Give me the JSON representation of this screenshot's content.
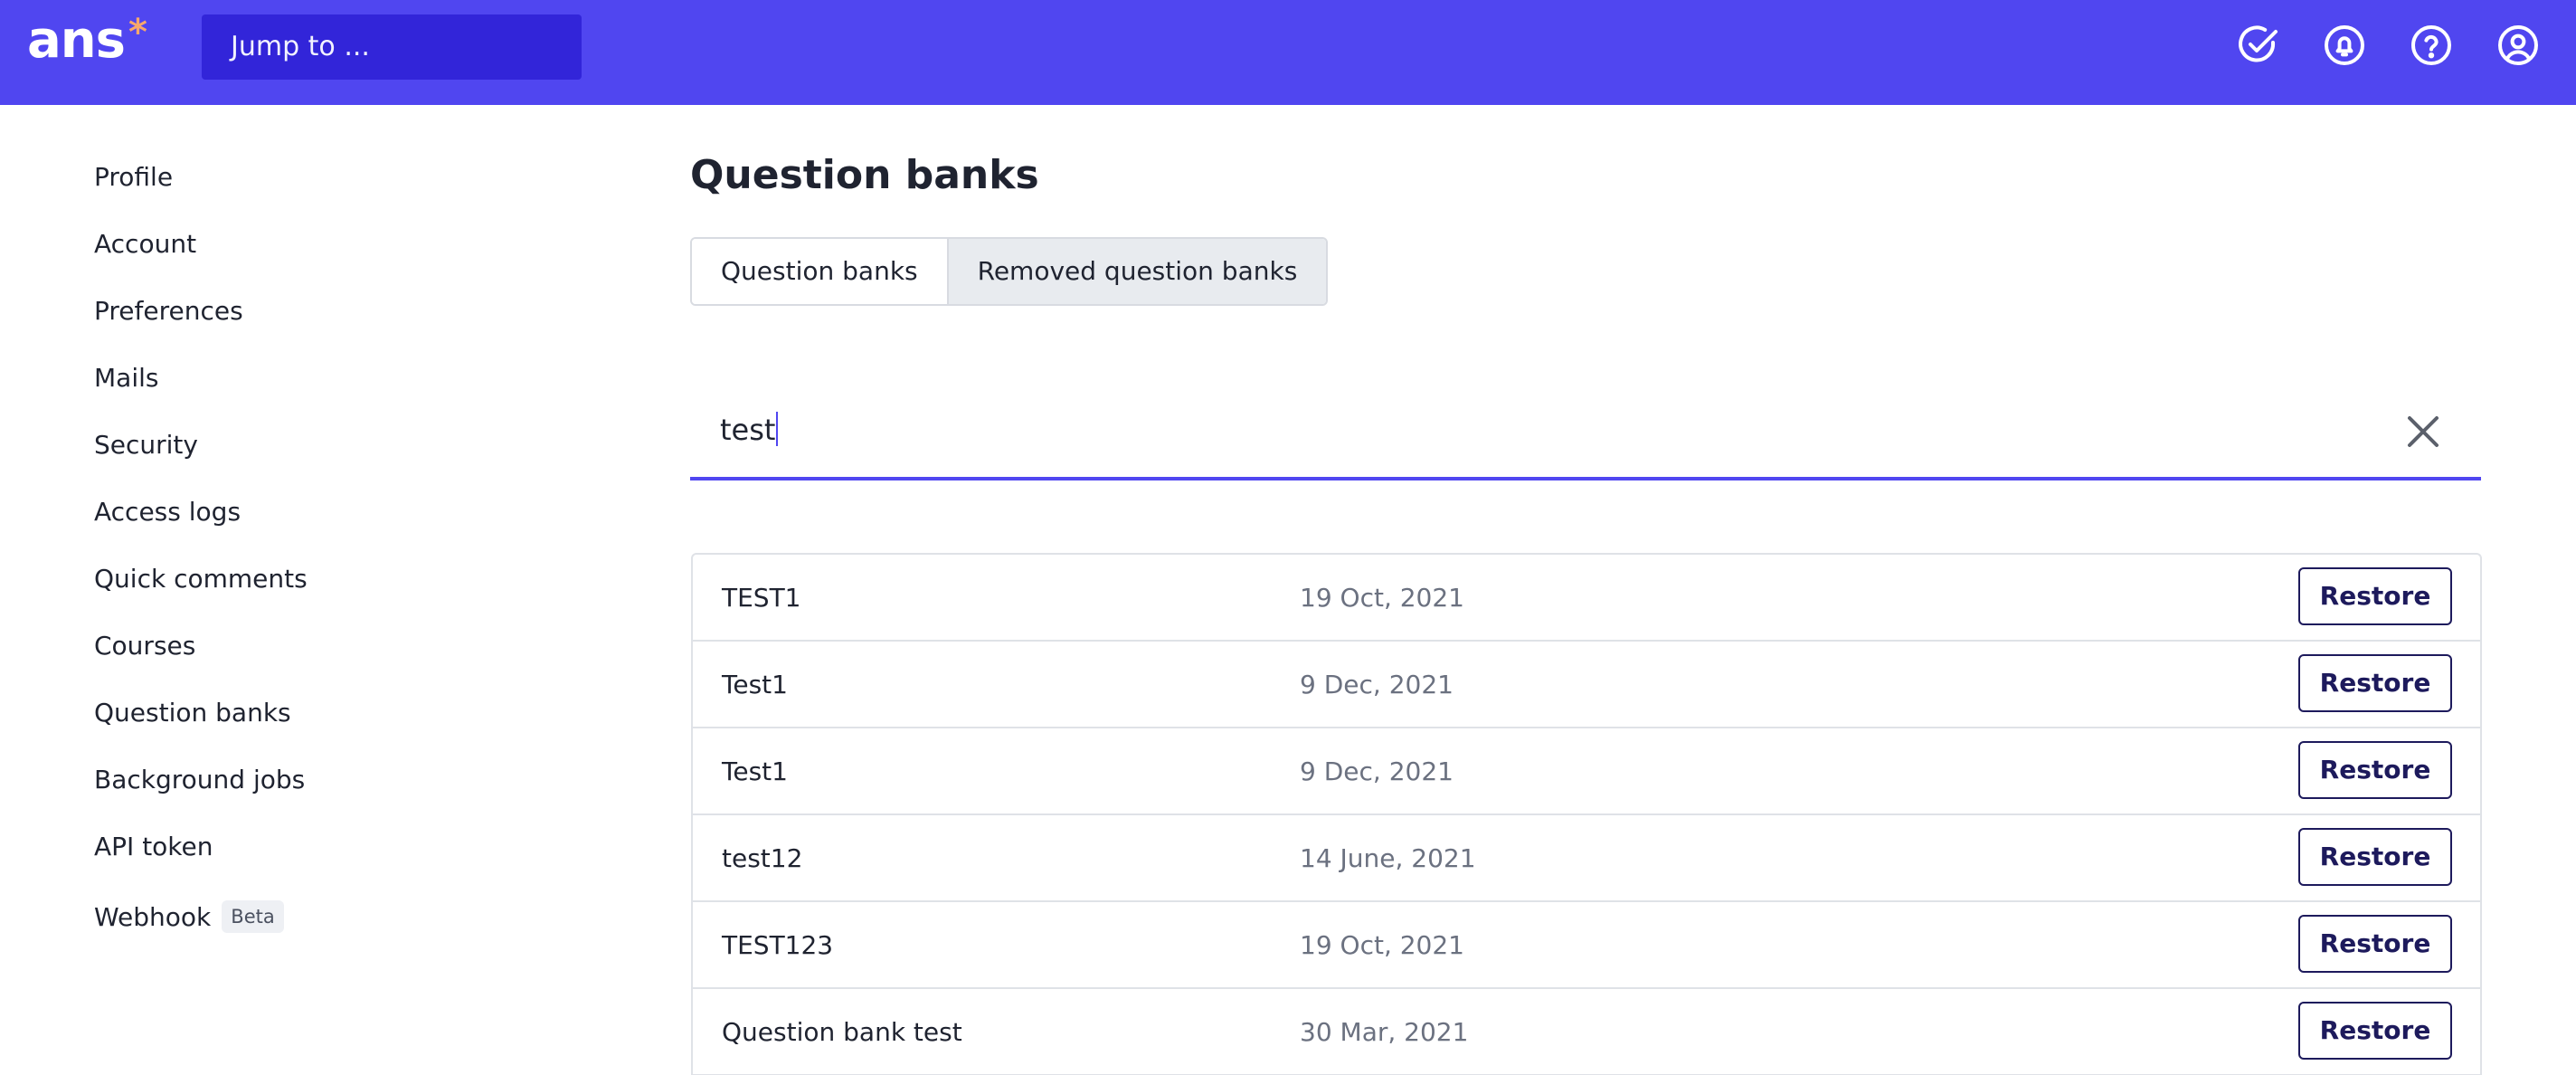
{
  "header": {
    "logo_text": "ans",
    "logo_star": "*",
    "jump_placeholder": "Jump to ...",
    "icons": [
      "check-circle-icon",
      "bell-icon",
      "help-icon",
      "user-icon"
    ],
    "colors": {
      "bar": "#5046f0",
      "jump": "#3225d9",
      "logo_star": "#f7a86c"
    }
  },
  "sidebar": {
    "items": [
      {
        "label": "Profile"
      },
      {
        "label": "Account"
      },
      {
        "label": "Preferences"
      },
      {
        "label": "Mails"
      },
      {
        "label": "Security"
      },
      {
        "label": "Access logs"
      },
      {
        "label": "Quick comments"
      },
      {
        "label": "Courses"
      },
      {
        "label": "Question banks"
      },
      {
        "label": "Background jobs"
      },
      {
        "label": "API token"
      },
      {
        "label": "Webhook",
        "badge": "Beta"
      }
    ]
  },
  "main": {
    "title": "Question banks",
    "tabs": [
      {
        "label": "Question banks",
        "active": false
      },
      {
        "label": "Removed question banks",
        "active": true
      }
    ],
    "search": {
      "value": "test"
    },
    "restore_label": "Restore",
    "rows": [
      {
        "name": "TEST1",
        "date": "19 Oct, 2021"
      },
      {
        "name": "Test1",
        "date": "9 Dec, 2021"
      },
      {
        "name": "Test1",
        "date": "9 Dec, 2021"
      },
      {
        "name": "test12",
        "date": "14 June, 2021"
      },
      {
        "name": "TEST123",
        "date": "19 Oct, 2021"
      },
      {
        "name": "Question bank test",
        "date": "30 Mar, 2021"
      }
    ]
  }
}
